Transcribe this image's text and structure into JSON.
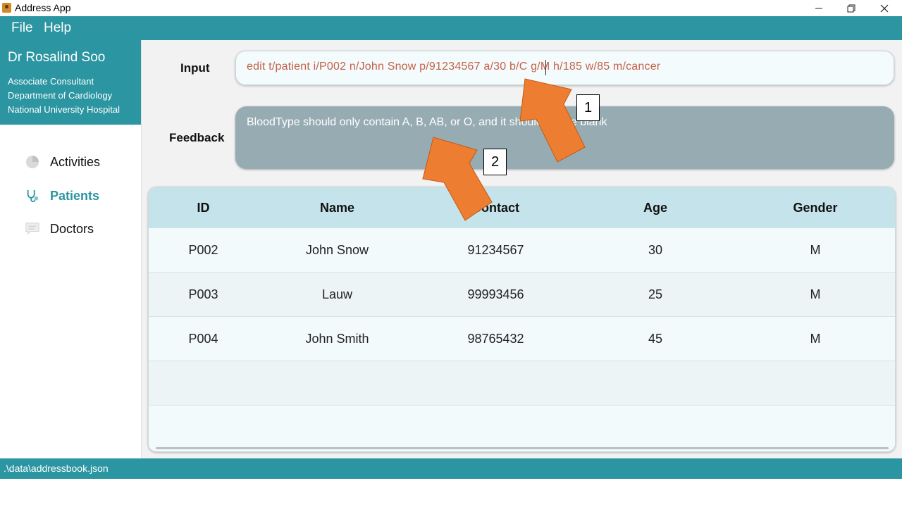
{
  "window": {
    "title": "Address App"
  },
  "menu": [
    "File",
    "Help"
  ],
  "profile": {
    "name": "Dr Rosalind Soo",
    "lines": [
      "Associate Consultant",
      "Department of Cardiology",
      "National University Hospital"
    ]
  },
  "nav": [
    {
      "label": "Activities",
      "icon": "pie-chart-icon",
      "active": false
    },
    {
      "label": "Patients",
      "icon": "stethoscope-icon",
      "active": true
    },
    {
      "label": "Doctors",
      "icon": "chat-icon",
      "active": false
    }
  ],
  "input": {
    "label": "Input",
    "value": "edit t/patient i/P002 n/John Snow p/91234567 a/30 b/C g/M h/185 w/85 m/cancer"
  },
  "feedback": {
    "label": "Feedback",
    "text": "BloodType should only contain A, B, AB, or O, and it should not be blank"
  },
  "table": {
    "columns": [
      "ID",
      "Name",
      "Contact",
      "Age",
      "Gender"
    ],
    "rows": [
      [
        "P002",
        "John Snow",
        "91234567",
        "30",
        "M"
      ],
      [
        "P003",
        "Lauw",
        "99993456",
        "25",
        "M"
      ],
      [
        "P004",
        "John Smith",
        "98765432",
        "45",
        "M"
      ]
    ]
  },
  "status": {
    "path": ".\\data\\addressbook.json"
  },
  "annotations": [
    "1",
    "2"
  ],
  "colors": {
    "accent": "#2b95a2",
    "input_text": "#c4614a",
    "feedback_bg": "#97abb3",
    "header_bg": "#c5e3ea",
    "arrow": "#ed7d31"
  }
}
